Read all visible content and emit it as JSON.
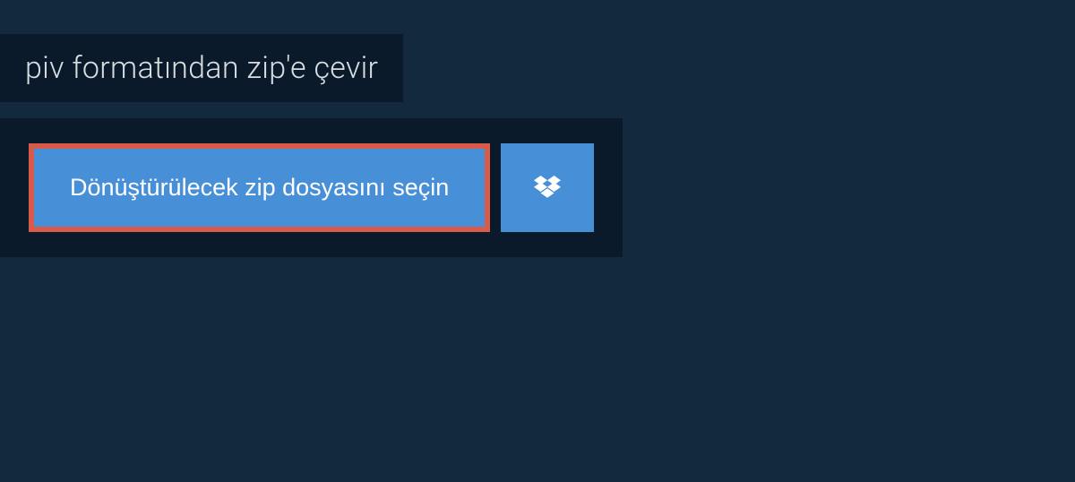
{
  "header": {
    "title": "piv formatından zip'e çevir"
  },
  "actions": {
    "selectFileLabel": "Dönüştürülecek zip dosyasını seçin",
    "dropboxIcon": "dropbox-icon"
  },
  "colors": {
    "background": "#13293d",
    "panel": "#0a1a2a",
    "buttonBlue": "#4790d8",
    "buttonBorder": "#d75a4a",
    "text": "#d8dde2"
  }
}
